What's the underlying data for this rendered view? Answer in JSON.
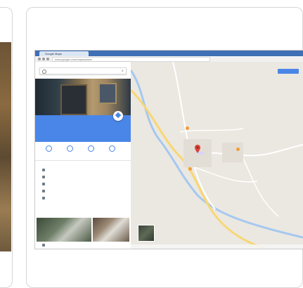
{
  "browser": {
    "tab_label": "Google Maps",
    "url": "www.google.com/maps/place/"
  },
  "panel": {
    "search_value": "",
    "close_symbol": "×",
    "place_title": "",
    "place_subtitle": "",
    "route_label": "",
    "actions": [
      {
        "label": "",
        "icon": "save-icon"
      },
      {
        "label": "",
        "icon": "nearby-icon"
      },
      {
        "label": "",
        "icon": "send-icon"
      },
      {
        "label": "",
        "icon": "share-icon"
      }
    ],
    "info_rows": [
      {
        "text": "",
        "icon": "location-pin-icon"
      },
      {
        "text": "",
        "icon": "web-icon"
      },
      {
        "text": "",
        "icon": "phone-icon"
      },
      {
        "text": "",
        "icon": "clock-icon"
      },
      {
        "text": "",
        "icon": "globe-icon"
      }
    ],
    "footer_text": ""
  },
  "map": {
    "labels": [
      "",
      "",
      ""
    ],
    "sign_in_label": "",
    "footer_text": "",
    "colors": {
      "road_major": "#f7d774",
      "road_minor": "#ffffff",
      "pin": "#db4437",
      "water": "#a5c8f0",
      "accent": "#4a86e8"
    }
  }
}
